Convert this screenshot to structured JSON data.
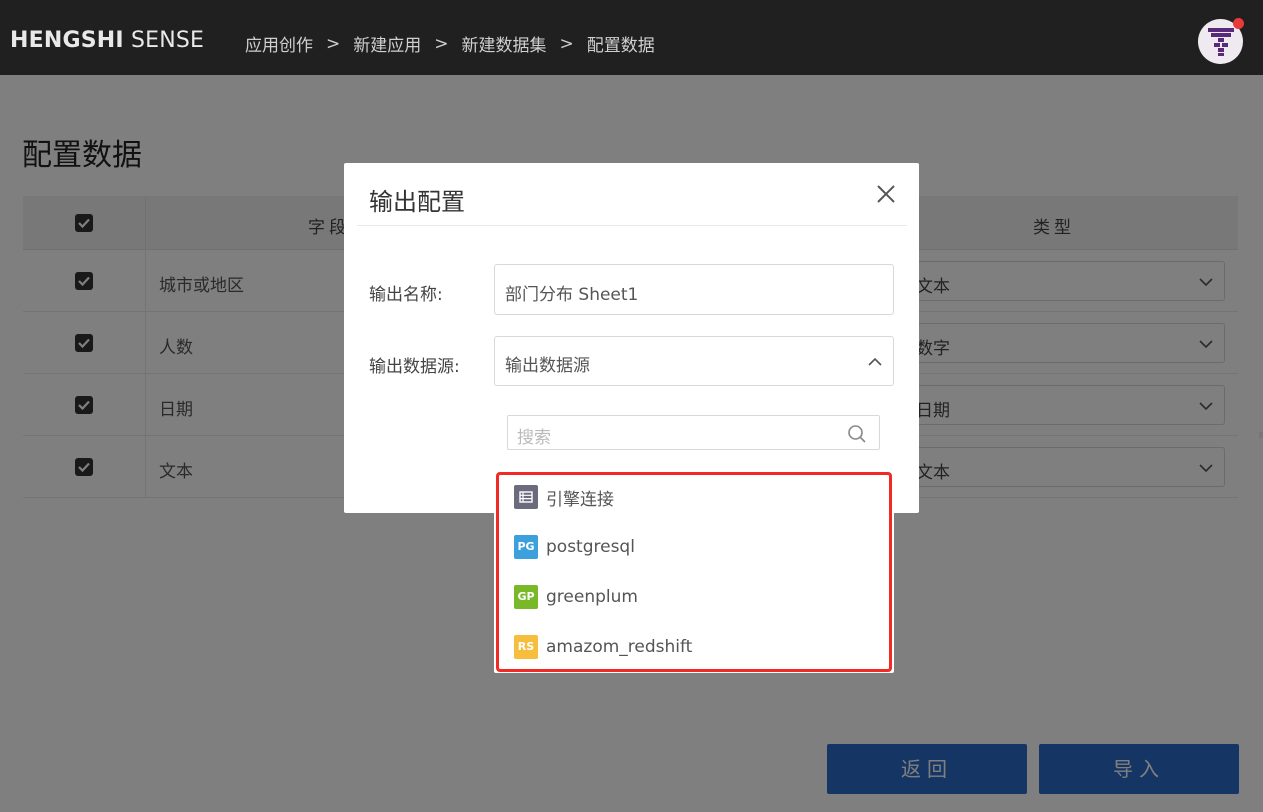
{
  "header": {
    "brand_bold": "HENGSHI",
    "brand_light": "SENSE",
    "breadcrumbs": [
      "应用创作",
      "新建应用",
      "新建数据集",
      "配置数据"
    ],
    "separator": ">",
    "colors": {
      "bar": "#202020",
      "notification": "#e83a3a"
    }
  },
  "page": {
    "title": "配置数据",
    "table": {
      "columns": {
        "field": "字段",
        "type": "类型"
      },
      "rows": [
        {
          "field": "城市或地区",
          "type": "文本",
          "checked": true
        },
        {
          "field": "人数",
          "type": "数字",
          "checked": true
        },
        {
          "field": "日期",
          "type": "日期",
          "checked": true
        },
        {
          "field": "文本",
          "type": "文本",
          "checked": true
        }
      ]
    },
    "buttons": {
      "back": "返回",
      "import": "导入"
    },
    "accent_color": "#2b6cc9"
  },
  "modal": {
    "title": "输出配置",
    "close_icon": "close-icon",
    "name_label": "输出名称:",
    "name_value": "部门分布 Sheet1",
    "source_label": "输出数据源:",
    "source_placeholder": "输出数据源",
    "dropdown": {
      "search_placeholder": "搜索",
      "items": [
        {
          "badge": "",
          "icon": "database-icon",
          "label": "引擎连接",
          "color": "#6b6b7d"
        },
        {
          "badge": "PG",
          "icon": "postgresql-icon",
          "label": "postgresql",
          "color": "#3ba0db"
        },
        {
          "badge": "GP",
          "icon": "greenplum-icon",
          "label": "greenplum",
          "color": "#79b928"
        },
        {
          "badge": "RS",
          "icon": "redshift-icon",
          "label": "amazom_redshift",
          "color": "#f6be3c"
        }
      ],
      "highlight_color": "#f22a23"
    }
  }
}
